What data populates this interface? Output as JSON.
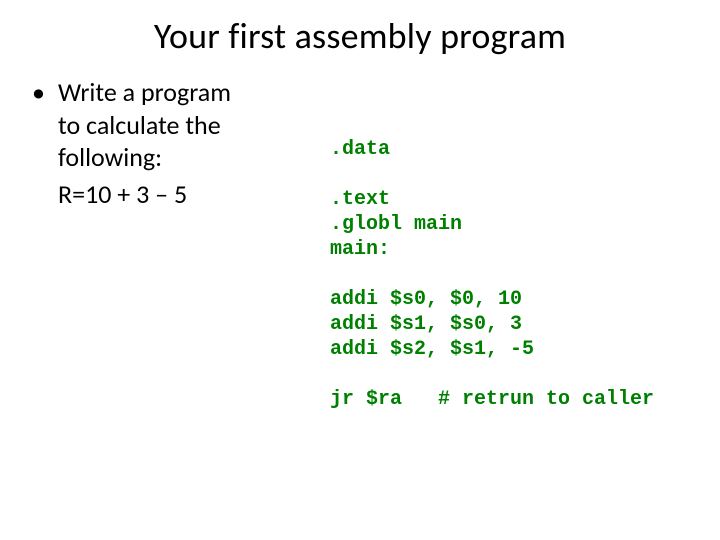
{
  "title": "Your first assembly program",
  "left": {
    "bullet_mark": "•",
    "line1": "Write a program",
    "line2": "to calculate the",
    "line3": "following:",
    "equation": "R=10 + 3 – 5"
  },
  "code": {
    "l1": ".data",
    "l2": ".text",
    "l3": ".globl main",
    "l4": "main:",
    "l5": "addi $s0, $0, 10",
    "l6": "addi $s1, $s0, 3",
    "l7": "addi $s2, $s1, -5",
    "l8": "jr $ra   # retrun to caller"
  }
}
